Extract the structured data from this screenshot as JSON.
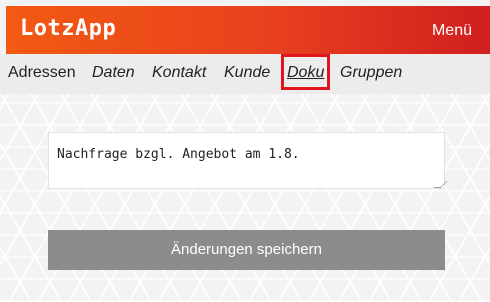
{
  "app": {
    "title": "LotzApp",
    "menu_label": "Menü",
    "header_gradient": [
      "#f25a12",
      "#d01f1f"
    ]
  },
  "nav": {
    "items": [
      {
        "label": "Adressen",
        "italic": false
      },
      {
        "label": "Daten",
        "italic": true
      },
      {
        "label": "Kontakt",
        "italic": true
      },
      {
        "label": "Kunde",
        "italic": true
      },
      {
        "label": "Doku",
        "italic": true,
        "active": true,
        "highlighted": true
      },
      {
        "label": "Gruppen",
        "italic": true
      }
    ]
  },
  "doku": {
    "note_value": "Nachfrage bzgl. Angebot am 1.8.",
    "save_label": "Änderungen speichern"
  },
  "colors": {
    "highlight": "#e3151c",
    "button": "#8c8c8c"
  }
}
